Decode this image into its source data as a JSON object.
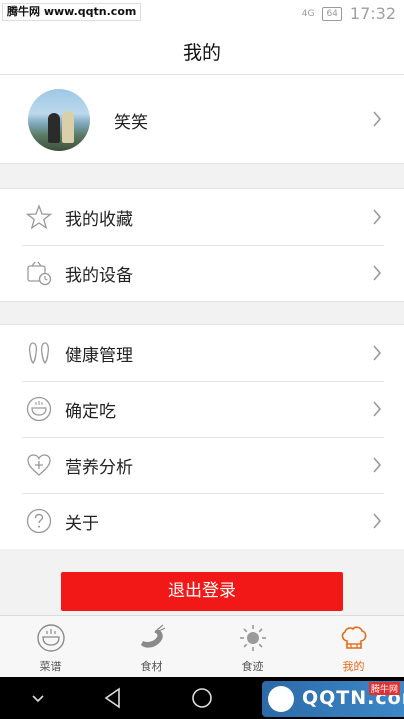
{
  "status_bar": {
    "watermark": "腾牛网 www.qqtn.com",
    "network_label": "4G",
    "battery": "64",
    "time": "17:32"
  },
  "header": {
    "title": "我的"
  },
  "profile": {
    "name": "笑笑"
  },
  "menu_group_1": [
    {
      "label": "我的收藏",
      "icon": "star-icon"
    },
    {
      "label": "我的设备",
      "icon": "device-clock-icon"
    }
  ],
  "menu_group_2": [
    {
      "label": "健康管理",
      "icon": "footprints-icon"
    },
    {
      "label": "确定吃",
      "icon": "bowl-icon"
    },
    {
      "label": "营养分析",
      "icon": "heart-plus-icon"
    },
    {
      "label": "关于",
      "icon": "question-icon"
    }
  ],
  "logout": {
    "label": "退出登录",
    "color": "#f21818"
  },
  "tabs": [
    {
      "label": "菜谱",
      "icon": "bowl-icon",
      "active": false
    },
    {
      "label": "食材",
      "icon": "shrimp-icon",
      "active": false
    },
    {
      "label": "食迹",
      "icon": "sun-icon",
      "active": false
    },
    {
      "label": "我的",
      "icon": "chef-hat-icon",
      "active": true
    }
  ],
  "accent_color": "#e56a1a",
  "watermark_bottom": {
    "text": "QQTN.com",
    "badge": "腾牛网"
  }
}
